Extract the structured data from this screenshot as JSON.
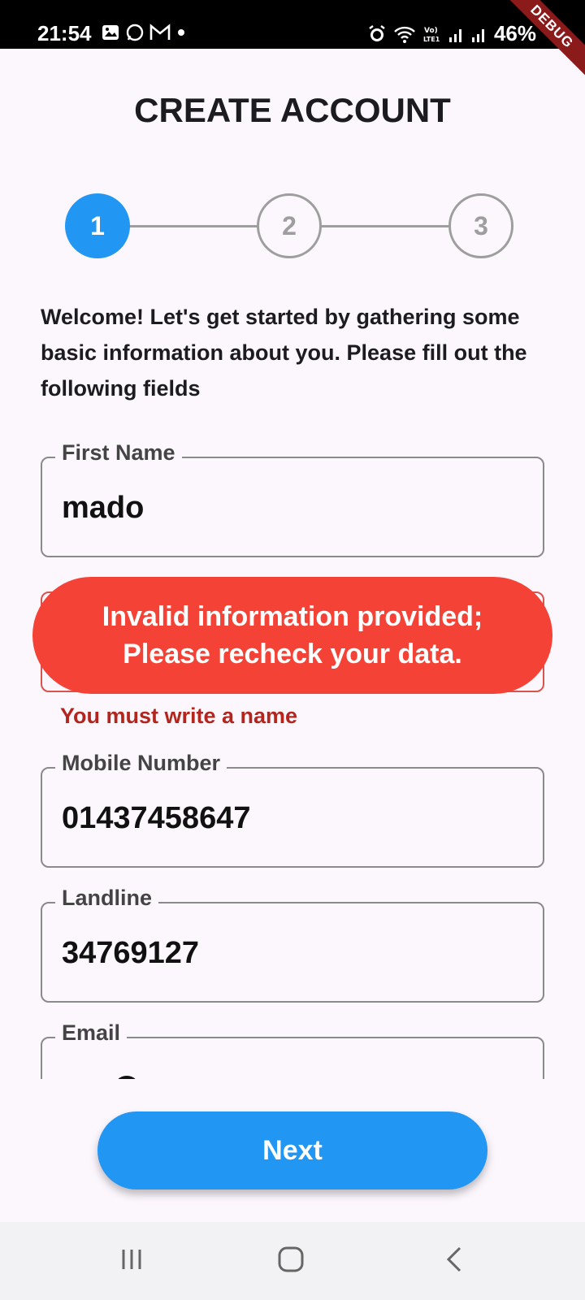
{
  "status_bar": {
    "time": "21:54",
    "battery": "46%",
    "left_icons": [
      "image-icon",
      "whatsapp-icon",
      "gmail-icon",
      "dot-icon"
    ],
    "right_icons": [
      "alarm-icon",
      "wifi-icon",
      "volte-icon",
      "signal-icon",
      "signal-icon"
    ]
  },
  "debug_banner": "DEBUG",
  "page": {
    "title": "CREATE ACCOUNT"
  },
  "stepper": {
    "steps": [
      {
        "label": "1",
        "active": true
      },
      {
        "label": "2",
        "active": false
      },
      {
        "label": "3",
        "active": false
      }
    ]
  },
  "intro_text": "Welcome! Let's get started by gathering some basic information about you. Please fill out the following fields",
  "form": {
    "first_name": {
      "label": "First Name",
      "value": "mado"
    },
    "last_name": {
      "error": "You must write a name"
    },
    "mobile": {
      "label": "Mobile Number",
      "value": "01437458647"
    },
    "landline": {
      "label": "Landline",
      "value": "34769127"
    },
    "email": {
      "label": "Email"
    }
  },
  "toast": {
    "line1": "Invalid information provided;",
    "line2": "Please recheck your data."
  },
  "next_button": "Next",
  "colors": {
    "primary": "#2196f3",
    "error": "#f44336",
    "error_text": "#b3261e",
    "background": "#fcf6fd"
  }
}
